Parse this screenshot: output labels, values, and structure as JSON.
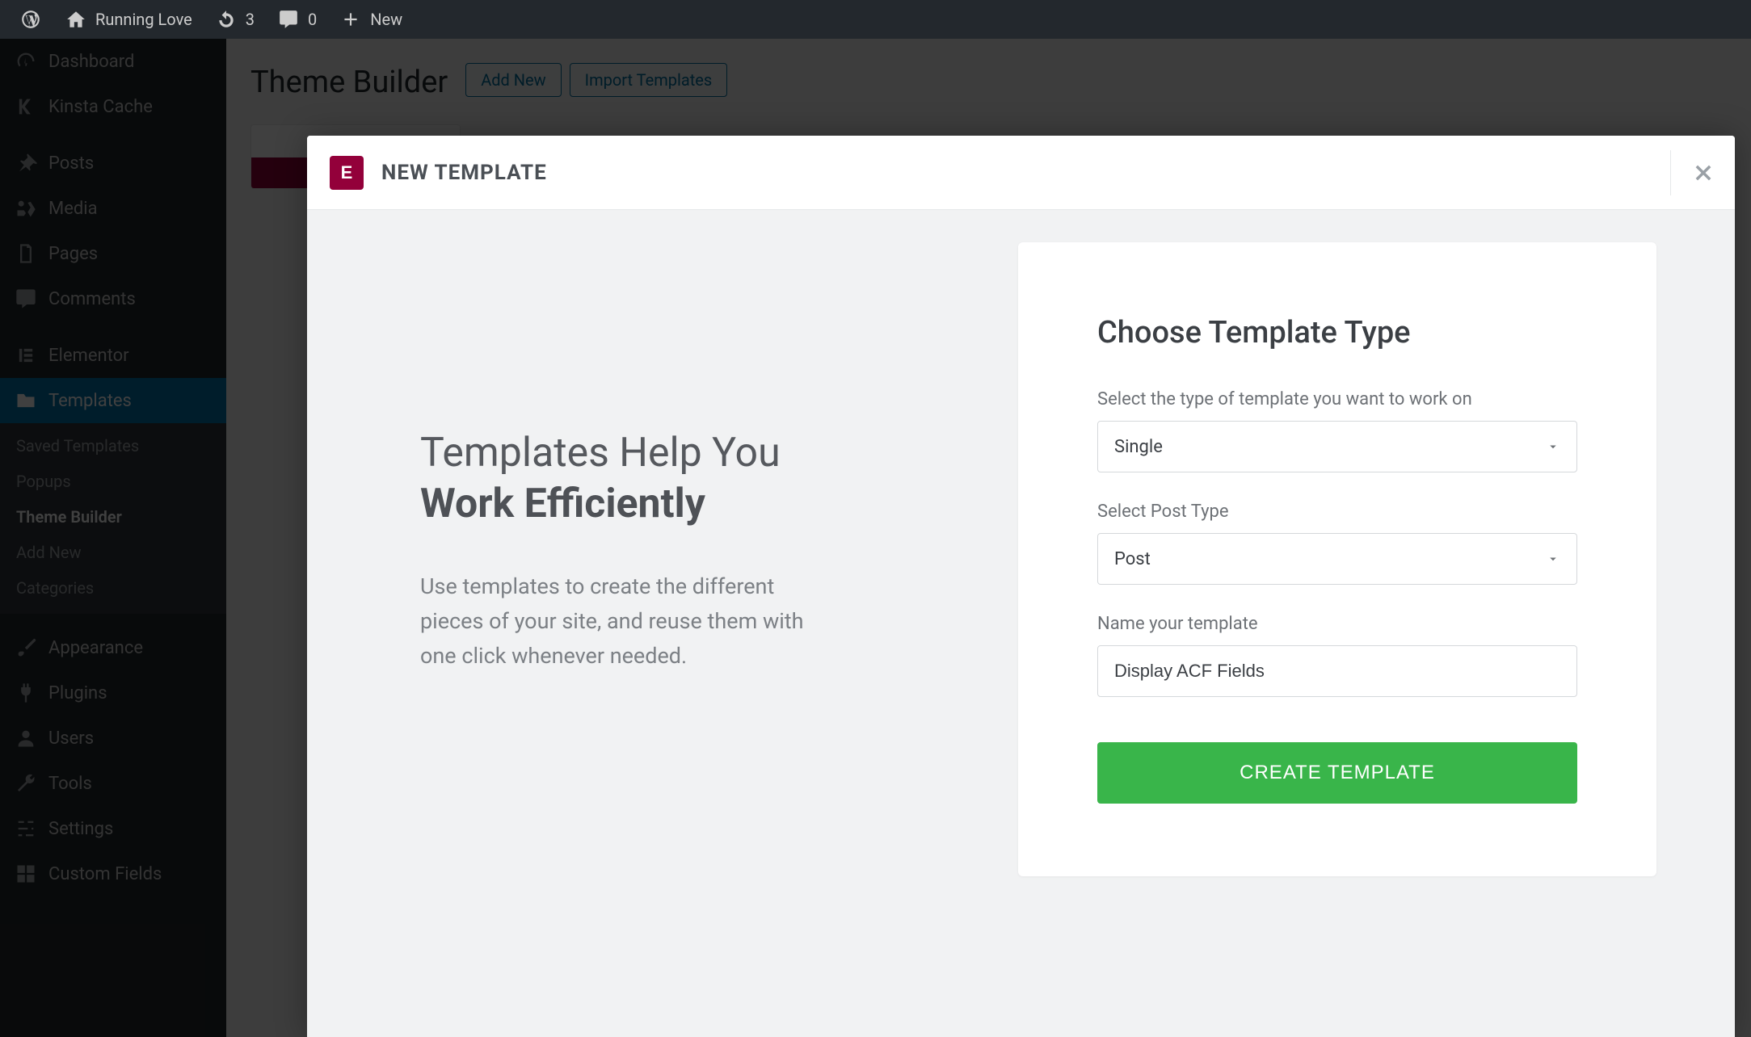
{
  "adminbar": {
    "site_name": "Running Love",
    "updates_count": "3",
    "comments_count": "0",
    "new_label": "New"
  },
  "sidebar": {
    "items": [
      {
        "label": "Dashboard"
      },
      {
        "label": "Kinsta Cache"
      },
      {
        "label": "Posts"
      },
      {
        "label": "Media"
      },
      {
        "label": "Pages"
      },
      {
        "label": "Comments"
      },
      {
        "label": "Elementor"
      },
      {
        "label": "Templates"
      },
      {
        "label": "Appearance"
      },
      {
        "label": "Plugins"
      },
      {
        "label": "Users"
      },
      {
        "label": "Tools"
      },
      {
        "label": "Settings"
      },
      {
        "label": "Custom Fields"
      }
    ],
    "templates_sub": [
      {
        "label": "Saved Templates"
      },
      {
        "label": "Popups"
      },
      {
        "label": "Theme Builder"
      },
      {
        "label": "Add New"
      },
      {
        "label": "Categories"
      }
    ]
  },
  "main": {
    "heading": "Theme Builder",
    "add_new_btn": "Add New",
    "import_btn": "Import Templates"
  },
  "modal": {
    "title": "NEW TEMPLATE",
    "promo_line1": "Templates Help You",
    "promo_line2": "Work Efficiently",
    "promo_desc": "Use templates to create the different pieces of your site, and reuse them with one click whenever needed.",
    "form": {
      "heading": "Choose Template Type",
      "type_label": "Select the type of template you want to work on",
      "type_value": "Single",
      "post_type_label": "Select Post Type",
      "post_type_value": "Post",
      "name_label": "Name your template",
      "name_value": "Display ACF Fields",
      "create_btn": "CREATE TEMPLATE"
    }
  }
}
